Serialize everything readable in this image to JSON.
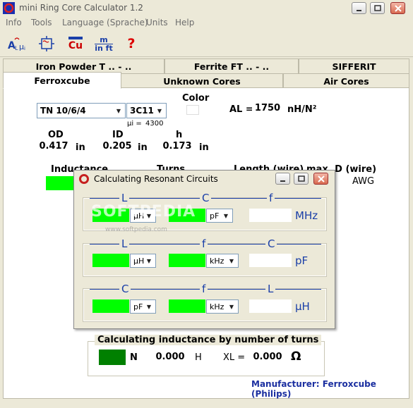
{
  "window": {
    "title": "mini Ring Core Calculator 1.2"
  },
  "menu": [
    "Info",
    "Tools",
    "Language (Sprache)",
    "Units",
    "Help"
  ],
  "toolbar": {
    "copper_label": "Cu",
    "unit_top": "m",
    "unit_bottom": "in ft",
    "help_label": "?"
  },
  "tabs": {
    "row1": [
      "Iron Powder T .. - ..",
      "Ferrite FT .. - ..",
      "SIFFERIT"
    ],
    "row2": [
      "Ferroxcube",
      "Unknown Cores",
      "Air Cores"
    ]
  },
  "core": {
    "type_value": "TN 10/6/4",
    "material_value": "3C11",
    "mu_label": "µi =",
    "mu_value": "4300",
    "color_label": "Color",
    "al_label": "AL =",
    "al_value": "1750",
    "al_unit": "nH/N²",
    "od_label": "OD",
    "od_value": "0.417",
    "id_label": "ID",
    "id_value": "0.205",
    "h_label": "h",
    "h_value": "0.173",
    "dim_unit": "in"
  },
  "columns": {
    "inductance": "Inductance",
    "turns": "Turns",
    "length_wire": "Length (wire)",
    "max_d_wire": "max. D (wire)",
    "awg_unit": "AWG"
  },
  "dialog": {
    "title": "Calculating Resonant Circuits",
    "groups": [
      {
        "heads": [
          "L",
          "C",
          "f"
        ],
        "unit1": "µH",
        "unit2": "pF",
        "result_unit": "MHz"
      },
      {
        "heads": [
          "L",
          "f",
          "C"
        ],
        "unit1": "µH",
        "unit2": "kHz",
        "result_unit": "pF"
      },
      {
        "heads": [
          "C",
          "f",
          "L"
        ],
        "unit1": "pF",
        "unit2": "kHz",
        "result_unit": "µH"
      }
    ],
    "watermark": "SOFTPEDIA",
    "watermark_url": "www.softpedia.com"
  },
  "turns_group": {
    "title": "Calculating inductance by number of turns",
    "n_label": "N",
    "l_value": "0.000",
    "l_unit": "H",
    "xl_label": "XL =",
    "xl_value": "0.000",
    "xl_unit": "Ω"
  },
  "manufacturer": "Manufacturer: Ferroxcube (Philips)",
  "colors": {
    "accent_blue": "#1a3fa8",
    "led_green": "#00ff00",
    "dark_green": "#008000",
    "manufacturer_blue": "#1b2fa0"
  }
}
